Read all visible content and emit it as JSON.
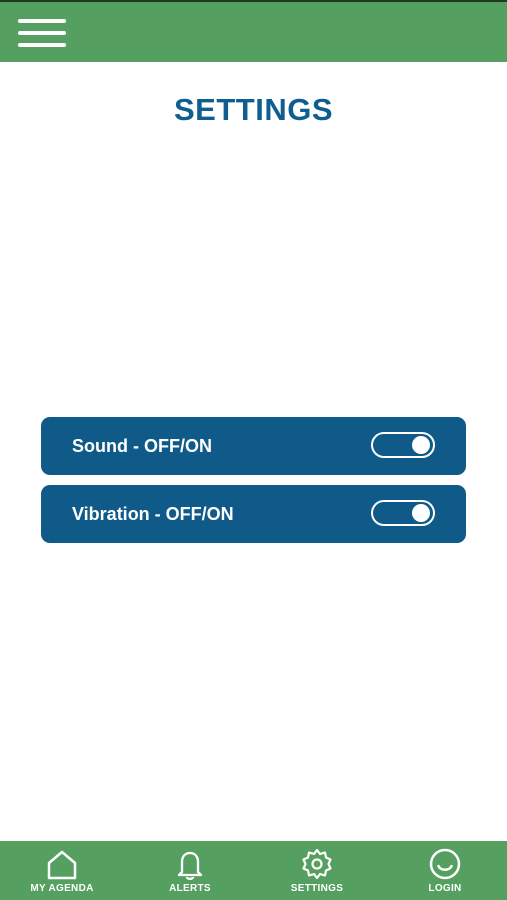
{
  "header": {
    "menu_icon": "hamburger-menu-icon"
  },
  "page": {
    "title": "SETTINGS"
  },
  "settings": [
    {
      "label": "Sound - OFF/ON",
      "state": "on"
    },
    {
      "label": "Vibration - OFF/ON",
      "state": "on"
    }
  ],
  "bottom_nav": [
    {
      "label": "MY AGENDA",
      "icon": "home-icon"
    },
    {
      "label": "ALERTS",
      "icon": "bell-icon"
    },
    {
      "label": "SETTINGS",
      "icon": "gear-icon"
    },
    {
      "label": "LOGIN",
      "icon": "smiley-face-icon"
    }
  ],
  "colors": {
    "bar_green": "#55a060",
    "title_blue": "#0f5e8f",
    "row_blue": "#0f5a88",
    "white": "#ffffff"
  }
}
